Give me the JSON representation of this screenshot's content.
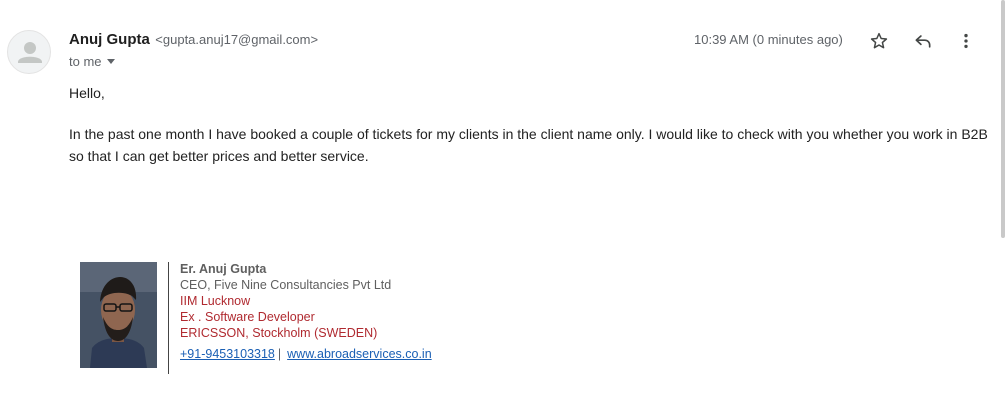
{
  "sender": {
    "name": "Anuj Gupta",
    "email": "<gupta.anuj17@gmail.com>",
    "avatar_icon": "person-icon",
    "recipient_label": "to me"
  },
  "meta": {
    "timestamp": "10:39 AM (0 minutes ago)"
  },
  "actions": {
    "star_icon": "star-icon",
    "reply_icon": "reply-icon",
    "more_icon": "more-vert-icon"
  },
  "body": {
    "greeting": "Hello,",
    "paragraph": "In the past one month I have booked a couple of tickets for my clients in the client name only. I would like to check with you whether you work in B2B so that I can get better prices and better service."
  },
  "signature": {
    "name": "Er. Anuj Gupta",
    "title": "CEO, Five Nine Consultancies Pvt Ltd",
    "line1": "IIM Lucknow",
    "line2": "Ex . Software Developer",
    "line3": "ERICSSON, Stockholm (SWEDEN)",
    "phone": "+91-9453103318",
    "separator": "|",
    "website": "www.abroadservices.co.in"
  },
  "colors": {
    "accent_red": "#b02a30",
    "link_blue": "#1a5fb4",
    "muted_gray": "#5f6368"
  }
}
